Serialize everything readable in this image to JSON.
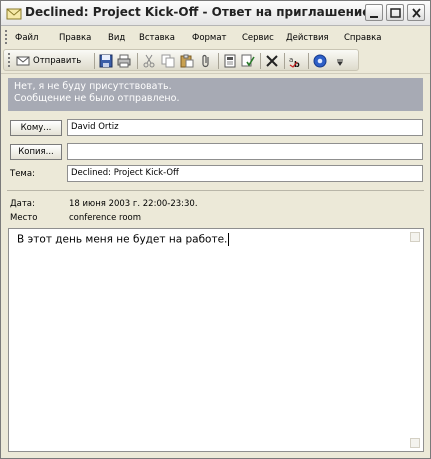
{
  "window": {
    "title": "Declined: Project Kick-Off - Ответ на приглашение"
  },
  "menu": [
    {
      "label": "Файл"
    },
    {
      "label": "Правка"
    },
    {
      "label": "Вид"
    },
    {
      "label": "Вставка"
    },
    {
      "label": "Формат"
    },
    {
      "label": "Сервис"
    },
    {
      "label": "Действия"
    },
    {
      "label": "Справка"
    }
  ],
  "toolbar": {
    "send_label": "Отправить"
  },
  "banner": {
    "line1": "Нет, я не буду присутствовать.",
    "line2": "Сообщение не было отправлено."
  },
  "fields": {
    "to_button": "Кому...",
    "to_value": "David Ortiz",
    "cc_button": "Копия...",
    "cc_value": "",
    "subject_label": "Тема:",
    "subject_value": "Declined: Project Kick-Off"
  },
  "meta": {
    "date_label": "Дата:",
    "date_value": "18 июня 2003 г. 22:00-23:30.",
    "place_label": "Место",
    "place_value": "conference room"
  },
  "body": {
    "text": "В этот день меня не будет на работе."
  },
  "colors": {
    "banner_bg": "#a7aab4",
    "window_bg": "#ece9d8"
  }
}
